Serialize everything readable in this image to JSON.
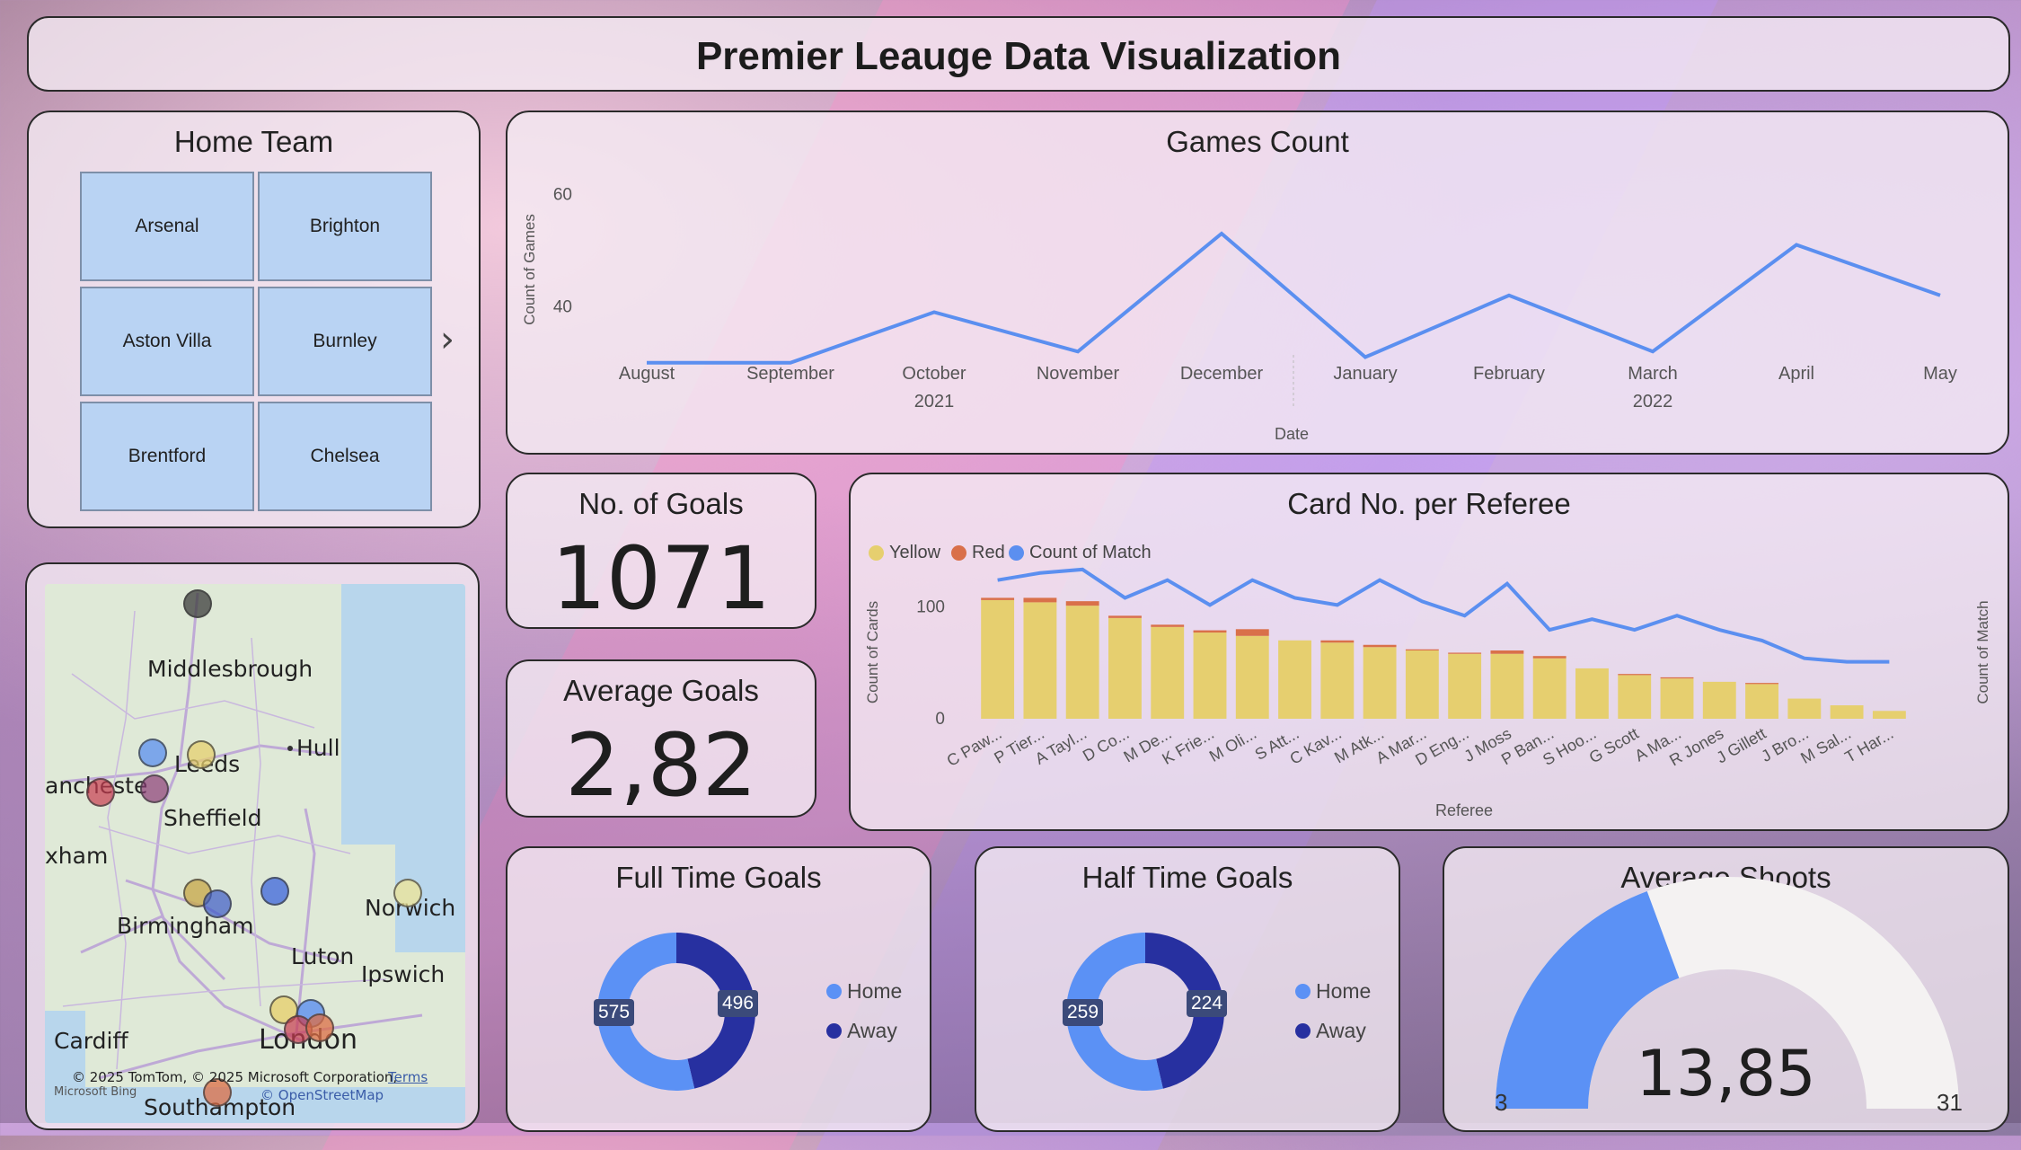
{
  "header": {
    "title": "Premier Leauge Data Visualization"
  },
  "slicer": {
    "title": "Home Team",
    "teams": [
      "Arsenal",
      "Brighton",
      "Aston Villa",
      "Burnley",
      "Brentford",
      "Chelsea"
    ],
    "next_icon": "chevron-right-icon"
  },
  "map": {
    "cities": [
      "Middlesbrough",
      "Hull",
      "Leeds",
      "ancheste",
      "Sheffield",
      "xham",
      "Birmingham",
      "Norwich",
      "Luton",
      "Ipswich",
      "Cardiff",
      "London",
      "Southampton"
    ],
    "credit": "© 2025 TomTom, © 2025 Microsoft Corporation,",
    "terms": "Terms",
    "bing": "Microsoft Bing",
    "osm": "© OpenStreetMap"
  },
  "kpi": {
    "goals_title": "No. of Goals",
    "goals_value": "1071",
    "avg_title": "Average Goals",
    "avg_value": "2,82"
  },
  "colors": {
    "line_blue": "#5b8ff0",
    "yellow": "#e6cf6f",
    "red": "#d9704a",
    "home_blue": "#5b91f5",
    "away_navy": "#2730a0",
    "gauge_fill": "#5b91f5",
    "gauge_track": "#f4f2f2"
  },
  "chart_data": [
    {
      "type": "line",
      "title": "Games Count",
      "xlabel": "Date",
      "ylabel": "Count of Games",
      "categories": [
        "August",
        "September",
        "October",
        "November",
        "December",
        "January",
        "February",
        "March",
        "April",
        "May"
      ],
      "year_labels": [
        "2021",
        "2022"
      ],
      "yticks": [
        40,
        60
      ],
      "ylim": [
        25,
        65
      ],
      "values": [
        30,
        30,
        39,
        32,
        53,
        31,
        42,
        32,
        51,
        42
      ],
      "grid": false
    },
    {
      "type": "bar",
      "title": "Card No. per Referee",
      "xlabel": "Referee",
      "ylabel": "Count of Cards",
      "y2label": "Count of Match",
      "legend": [
        "Yellow",
        "Red",
        "Count of Match"
      ],
      "legend_position": "top-left",
      "yticks": [
        0,
        100
      ],
      "ylim": [
        0,
        130
      ],
      "categories": [
        "C Paw...",
        "P Tier...",
        "A Tayl...",
        "D Co...",
        "M De...",
        "K Frie...",
        "M Oli...",
        "S Att...",
        "C Kav...",
        "M Atk...",
        "A Mar...",
        "D Eng...",
        "J Moss",
        "P Ban...",
        "S Hoo...",
        "G Scott",
        "A Ma...",
        "R Jones",
        "J Gillett",
        "J Bro...",
        "M Sal...",
        "T Har..."
      ],
      "series": [
        {
          "name": "Yellow",
          "values": [
            106,
            104,
            101,
            90,
            82,
            77,
            74,
            70,
            68,
            64,
            61,
            58,
            58,
            54,
            45,
            39,
            36,
            33,
            31,
            18,
            12,
            7
          ]
        },
        {
          "name": "Red",
          "values": [
            2,
            4,
            4,
            2,
            2,
            2,
            6,
            0,
            2,
            2,
            1,
            1,
            3,
            2,
            0,
            1,
            1,
            0,
            1,
            0,
            0,
            0
          ]
        },
        {
          "name": "Count of Match",
          "values": [
            38,
            40,
            41,
            33,
            38,
            31,
            38,
            33,
            31,
            38,
            32,
            28,
            37,
            24,
            27,
            24,
            28,
            24,
            21,
            16,
            15,
            15
          ]
        }
      ]
    },
    {
      "type": "pie",
      "title": "Full Time Goals",
      "labels": [
        "Home",
        "Away"
      ],
      "values": [
        575,
        496
      ]
    },
    {
      "type": "pie",
      "title": "Half Time Goals",
      "labels": [
        "Home",
        "Away"
      ],
      "values": [
        259,
        224
      ]
    },
    {
      "type": "gauge",
      "title": "Average Shoots",
      "value": 13.85,
      "value_label": "13,85",
      "min": 3,
      "max": 31
    }
  ]
}
